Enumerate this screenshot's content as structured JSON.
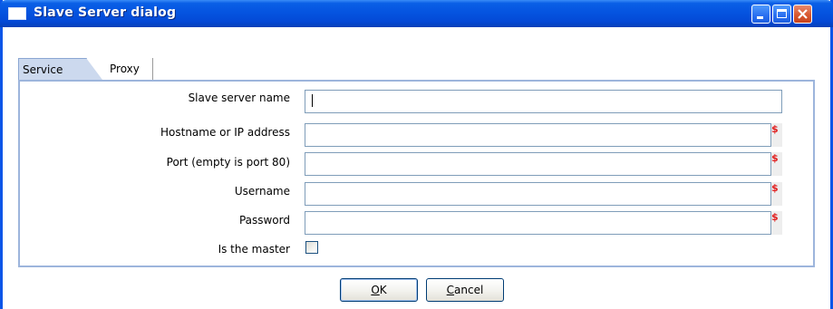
{
  "window": {
    "title": "Slave Server dialog"
  },
  "tabs": [
    {
      "label": "Service",
      "selected": true
    },
    {
      "label": "Proxy",
      "selected": false
    }
  ],
  "form": {
    "fields": [
      {
        "label": "Slave server name",
        "value": "",
        "has_variable_marker": false
      },
      {
        "label": "Hostname or IP address",
        "value": "",
        "has_variable_marker": true
      },
      {
        "label": "Port (empty is port 80)",
        "value": "",
        "has_variable_marker": true
      },
      {
        "label": "Username",
        "value": "",
        "has_variable_marker": true
      },
      {
        "label": "Password",
        "value": "",
        "has_variable_marker": true
      }
    ],
    "variable_marker": "$",
    "master_label": "Is the master",
    "master_checked": false
  },
  "buttons": {
    "ok_mnemonic": "O",
    "ok_rest": "K",
    "cancel_mnemonic": "C",
    "cancel_rest": "ancel"
  },
  "colors": {
    "titlebar": "#0554e0",
    "variable_marker": "#e02020",
    "panel_border": "#9db5dc"
  }
}
